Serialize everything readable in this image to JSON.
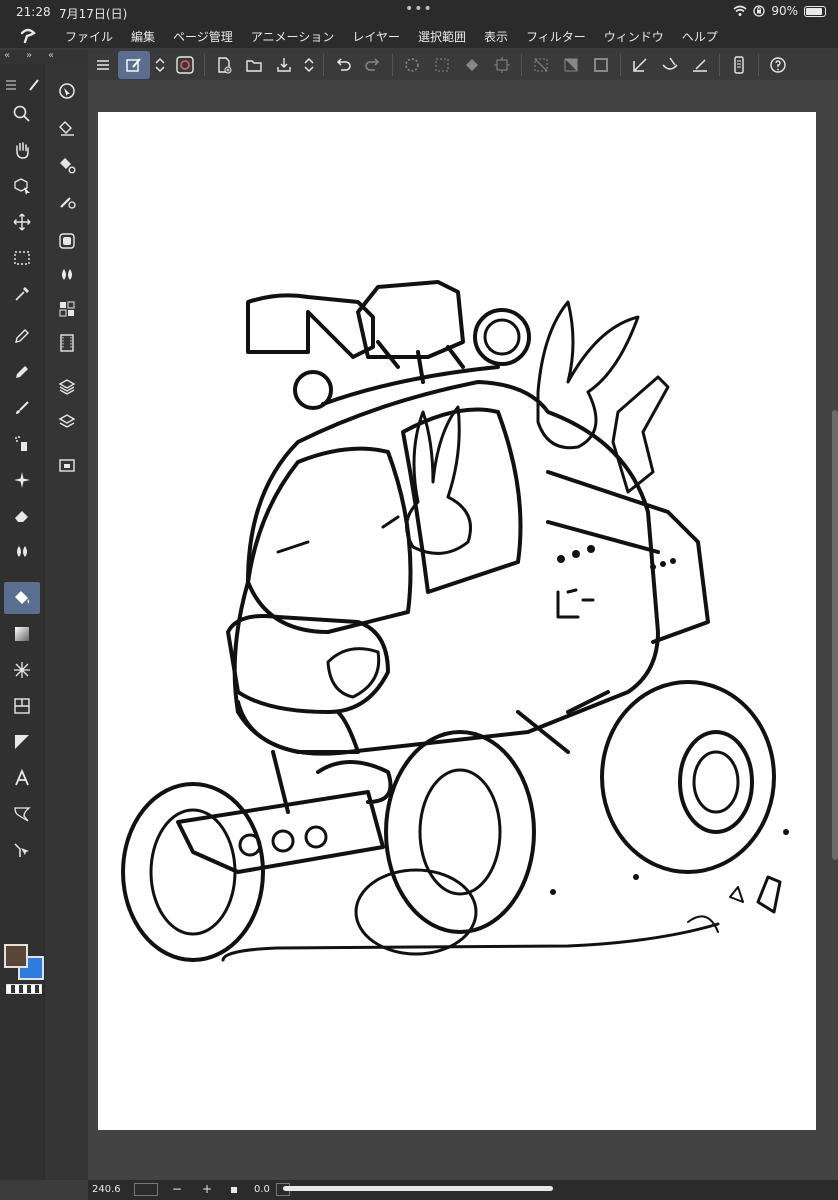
{
  "status_bar": {
    "time": "21:28",
    "date": "7月17日(日)",
    "battery": "90%"
  },
  "menu": {
    "items": [
      "ファイル",
      "編集",
      "ページ管理",
      "アニメーション",
      "レイヤー",
      "選択範囲",
      "表示",
      "フィルター",
      "ウィンドウ",
      "ヘルプ"
    ]
  },
  "colors": {
    "main_color": "#5a4636",
    "sub_color": "#2f7be0",
    "active_tool_bg": "#5a6f8f",
    "canvas_bg": "#ffffff"
  },
  "tools": [
    "search-icon",
    "hand-icon",
    "object-icon",
    "move-icon",
    "selection-icon",
    "eyedropper-icon",
    "pen-icon",
    "pencil-icon",
    "brush-icon",
    "airbrush-icon",
    "decoration-icon",
    "eraser-icon",
    "blend-icon",
    "fill-icon",
    "gradient-icon",
    "figure-icon",
    "frame-icon",
    "ruler-icon",
    "text-icon",
    "balloon-icon",
    "correct-line-icon"
  ],
  "bottom_bar": {
    "zoom": "240.6",
    "zoom_out": "−",
    "zoom_in": "+",
    "rotation": "0.0"
  }
}
